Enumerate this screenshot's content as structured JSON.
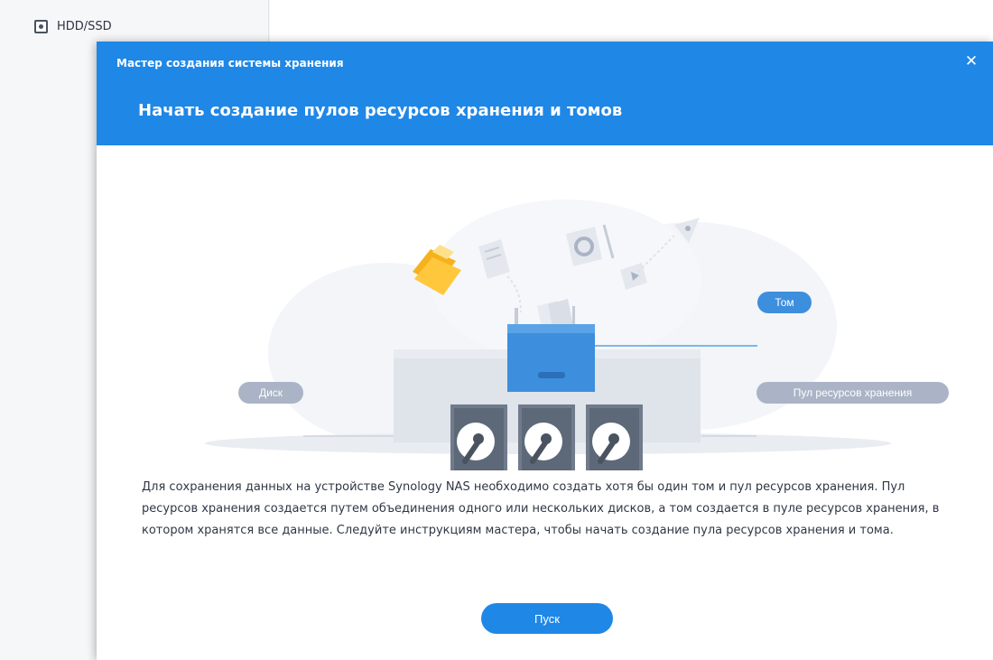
{
  "sidebar": {
    "items": [
      {
        "label": "HDD/SSD",
        "icon": "hdd-icon"
      }
    ]
  },
  "dialog": {
    "title": "Мастер создания системы хранения",
    "heading": "Начать создание пулов ресурсов хранения и томов",
    "close_icon": "close-icon",
    "illustration": {
      "tag_volume": "Том",
      "tag_disk": "Диск",
      "tag_pool": "Пул ресурсов хранения"
    },
    "description": "Для сохранения данных на устройстве Synology NAS необходимо создать хотя бы один том и пул ресурсов хранения. Пул ресурсов хранения создается путем объединения одного или нескольких дисков, а том создается в пуле ресурсов хранения, в котором хранятся все данные. Следуйте инструкциям мастера, чтобы начать создание пула ресурсов хранения и тома.",
    "start_label": "Пуск"
  },
  "colors": {
    "header_blue": "#1f87e6",
    "volume_blue": "#3d8fdd",
    "tag_gray": "#aab4c6"
  }
}
